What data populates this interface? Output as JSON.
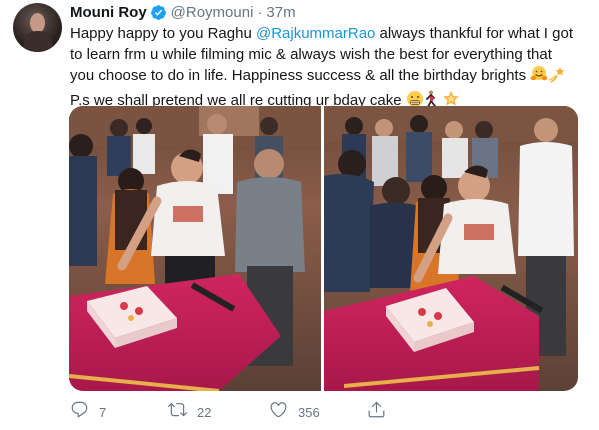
{
  "tweet": {
    "author_name": "Mouni Roy",
    "handle": "@Roymouni",
    "separator": "·",
    "time": "37m",
    "text_line1_a": "Happy happy to you Raghu ",
    "mention": "@RajkummarRao",
    "text_line1_b": " always thankful for what I got",
    "text_line2": "to learn frm u while filming mic & always wish the best for everything that",
    "text_line3": "you choose to do in life. Happiness success & all the birthday brights",
    "text_line4": "P.s we shall pretend we all re cutting ur bday cake",
    "colors": {
      "mention": "#1b95e0",
      "verified": "#1da1f2",
      "muted": "#657786"
    }
  },
  "media": {
    "images": [
      "party-cake-cutting-photo",
      "party-cake-cutting-photo"
    ]
  },
  "actions": {
    "reply_icon": "reply-icon",
    "reply_count": "7",
    "retweet_icon": "retweet-icon",
    "retweet_count": "22",
    "like_icon": "heart-icon",
    "like_count": "356",
    "share_icon": "share-icon"
  }
}
